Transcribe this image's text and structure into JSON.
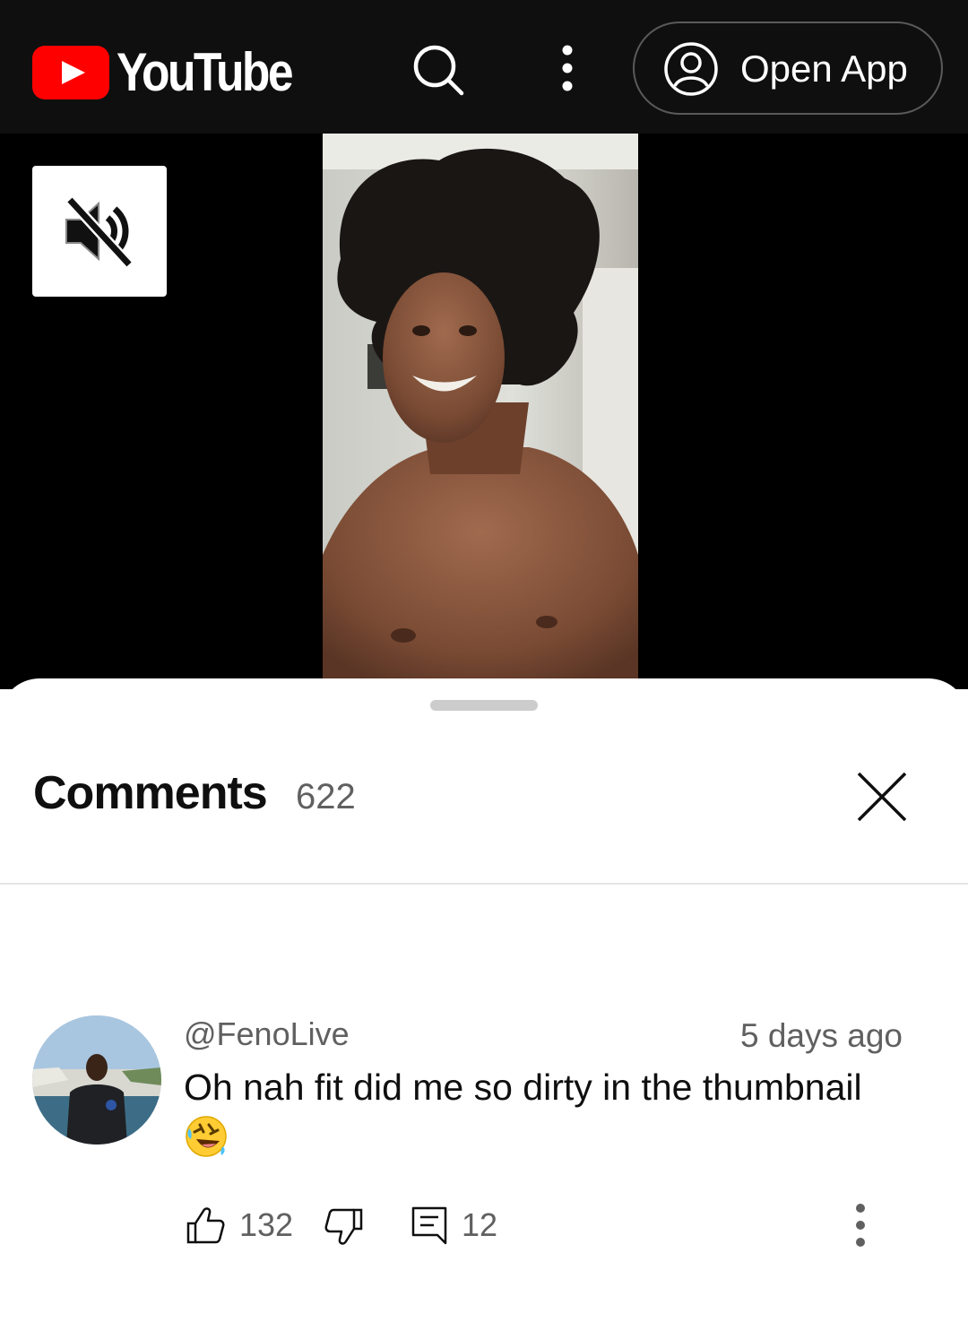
{
  "header": {
    "brand": "YouTube",
    "open_app_label": "Open App",
    "icons": [
      "search-icon",
      "more-vert-icon",
      "account-circle-icon"
    ]
  },
  "player": {
    "mute_icon": "volume-off-icon"
  },
  "comments": {
    "title": "Comments",
    "count": "622",
    "close_icon": "close-icon",
    "items": [
      {
        "author": "@FenoLive",
        "time": "5 days ago",
        "text": "Oh nah fit did me so dirty in the thumbnail",
        "emoji": "🤣",
        "likes": "132",
        "replies": "12"
      }
    ]
  },
  "colors": {
    "brand_red": "#ff0000",
    "topbar_bg": "#0f0f0f",
    "secondary_text": "#606060"
  }
}
